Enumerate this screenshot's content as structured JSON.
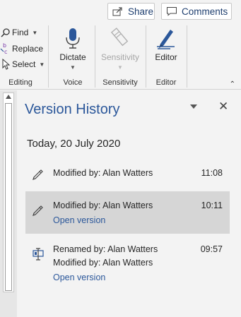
{
  "toolbar": {
    "share_label": "Share",
    "comments_label": "Comments"
  },
  "editing": {
    "find_label": "Find",
    "replace_label": "Replace",
    "select_label": "Select",
    "group_label": "Editing"
  },
  "voice": {
    "dictate_label": "Dictate",
    "group_label": "Voice"
  },
  "sensitivity": {
    "button_label": "Sensitivity",
    "group_label": "Sensitivity",
    "disabled": true
  },
  "editor": {
    "button_label": "Editor",
    "group_label": "Editor"
  },
  "pane": {
    "title": "Version History",
    "date_header": "Today, 20 July 2020",
    "versions": [
      {
        "icon": "pencil-icon",
        "lines": [
          "Modified by: Alan Watters"
        ],
        "time": "11:08",
        "selected": false,
        "link": ""
      },
      {
        "icon": "pencil-icon",
        "lines": [
          "Modified by: Alan Watters"
        ],
        "time": "10:11",
        "selected": true,
        "link": "Open version"
      },
      {
        "icon": "rename-icon",
        "lines": [
          "Renamed by: Alan Watters",
          "Modified by: Alan Watters"
        ],
        "time": "09:57",
        "selected": false,
        "link": "Open version"
      }
    ]
  },
  "colors": {
    "accent": "#2b579a",
    "selected_bg": "#d6d6d6",
    "background": "#f3f3f3"
  }
}
